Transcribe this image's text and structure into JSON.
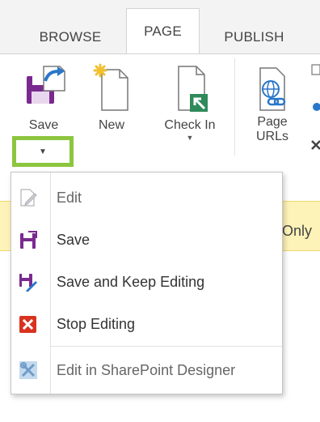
{
  "tabs": [
    {
      "label": "BROWSE",
      "active": false
    },
    {
      "label": "PAGE",
      "active": true
    },
    {
      "label": "PUBLISH",
      "active": false
    }
  ],
  "ribbon": {
    "save_label": "Save",
    "new_label": "New",
    "checkin_label": "Check In",
    "page_urls_line1": "Page",
    "page_urls_line2": "URLs"
  },
  "banner": {
    "text": "Only"
  },
  "menu": {
    "items": [
      {
        "label": "Edit",
        "icon": "edit-icon",
        "enabled": false
      },
      {
        "label": "Save",
        "icon": "save-icon",
        "enabled": true
      },
      {
        "label": "Save and Keep Editing",
        "icon": "save-keep-editing-icon",
        "enabled": true
      },
      {
        "label": "Stop Editing",
        "icon": "stop-editing-icon",
        "enabled": true
      },
      {
        "label": "Edit in SharePoint Designer",
        "icon": "sharepoint-designer-icon",
        "enabled": false
      }
    ]
  },
  "colors": {
    "accent_purple": "#7a2a8f",
    "highlight_green": "#8cc63f",
    "stop_red": "#d9331f",
    "banner_yellow": "#fdf3b8",
    "link_blue": "#2a77c9"
  }
}
